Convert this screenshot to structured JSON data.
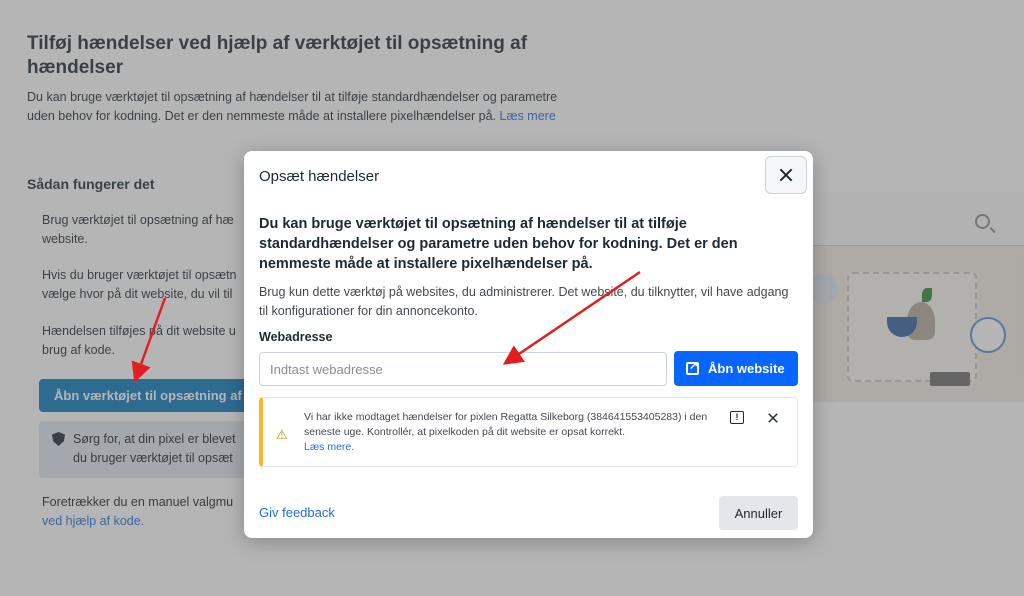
{
  "background": {
    "title": "Tilføj hændelser ved hjælp af værktøjet til opsætning af hændelser",
    "intro": "Du kan bruge værktøjet til opsætning af hændelser til at tilføje standardhændelser og parametre uden behov for kodning. Det er den nemmeste måde at installere pixelhændelser på.",
    "intro_link": "Læs mere",
    "how_heading": "Sådan fungerer det",
    "step1_line1": "Brug værktøjet til opsætning af hæ",
    "step1_line2": "website.",
    "step2_line1": "Hvis du bruger værktøjet til opsætn",
    "step2_line2": "vælge hvor på dit website, du vil til",
    "step3_line1": "Hændelsen tilføjes på dit website u",
    "step3_line2": "brug af kode.",
    "open_tool_button": "Åbn værktøjet til opsætning af h",
    "note_line1": "Sørg for, at din pixel er blevet",
    "note_line2": "du bruger værktøjet til opsæt",
    "pref_line1": "Foretrækker du en manuel valgmu",
    "pref_link": "ved hjælp af kode."
  },
  "dialog": {
    "title": "Opsæt hændelser",
    "headline": "Du kan bruge værktøjet til opsætning af hændelser til at tilføje standardhændelser og parametre uden behov for kodning. Det er den nemmeste måde at installere pixelhændelser på.",
    "description": "Brug kun dette værktøj på websites, du administrerer. Det website, du tilknytter, vil have adgang til konfigurationer for din annoncekonto.",
    "url_label": "Webadresse",
    "url_placeholder": "Indtast webadresse",
    "url_value": "",
    "open_button": "Åbn website",
    "warning": {
      "text": "Vi har ikke modtaget hændelser for pixlen Regatta Silkeborg (384641553405283) i den seneste uge. Kontrollér, at pixelkoden på dit website er opsat korrekt.",
      "link": "Læs mere."
    },
    "feedback_link": "Giv feedback",
    "cancel_button": "Annuller"
  },
  "colors": {
    "primary": "#0866ff",
    "warning_accent": "#f7b928",
    "annotation_arrow": "#e02020"
  },
  "icons": [
    "close-icon",
    "external-link-icon",
    "warning-icon",
    "feedback-icon",
    "shield-icon",
    "search-icon",
    "cart-icon"
  ]
}
